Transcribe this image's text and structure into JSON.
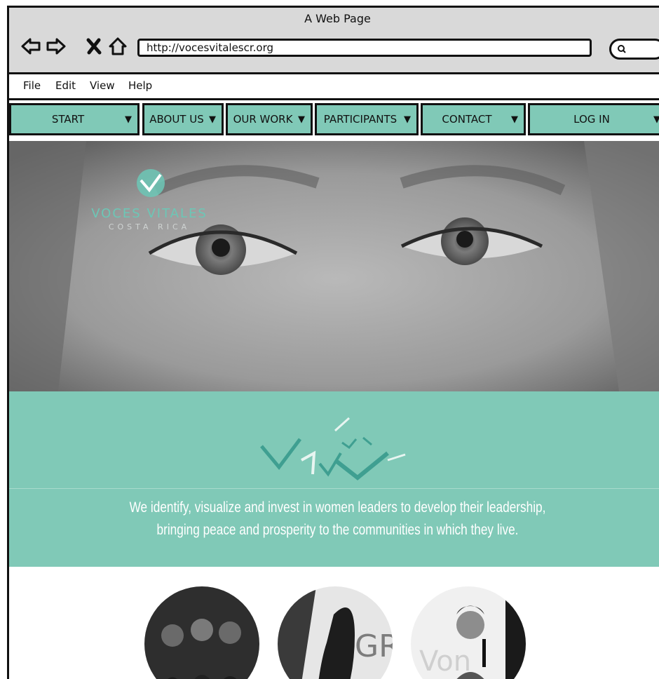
{
  "window": {
    "title": "A Web Page"
  },
  "browser": {
    "url": "http://vocesvitalescr.org"
  },
  "menu": [
    "File",
    "Edit",
    "View",
    "Help"
  ],
  "nav": [
    {
      "label": "START"
    },
    {
      "label": "ABOUT US"
    },
    {
      "label": "OUR WORK"
    },
    {
      "label": "PARTICIPANTS"
    },
    {
      "label": "CONTACT"
    },
    {
      "label": "LOG IN"
    }
  ],
  "logo": {
    "name": "VOCES VITALES",
    "sub": "COSTA RICA"
  },
  "mission": {
    "line1": "We identify, visualize and invest in women leaders to develop their leadership,",
    "line2": "bringing peace and prosperity to the communities in which they live."
  },
  "colors": {
    "accent": "#80c9b7",
    "logo_teal": "#6cc7b6"
  }
}
